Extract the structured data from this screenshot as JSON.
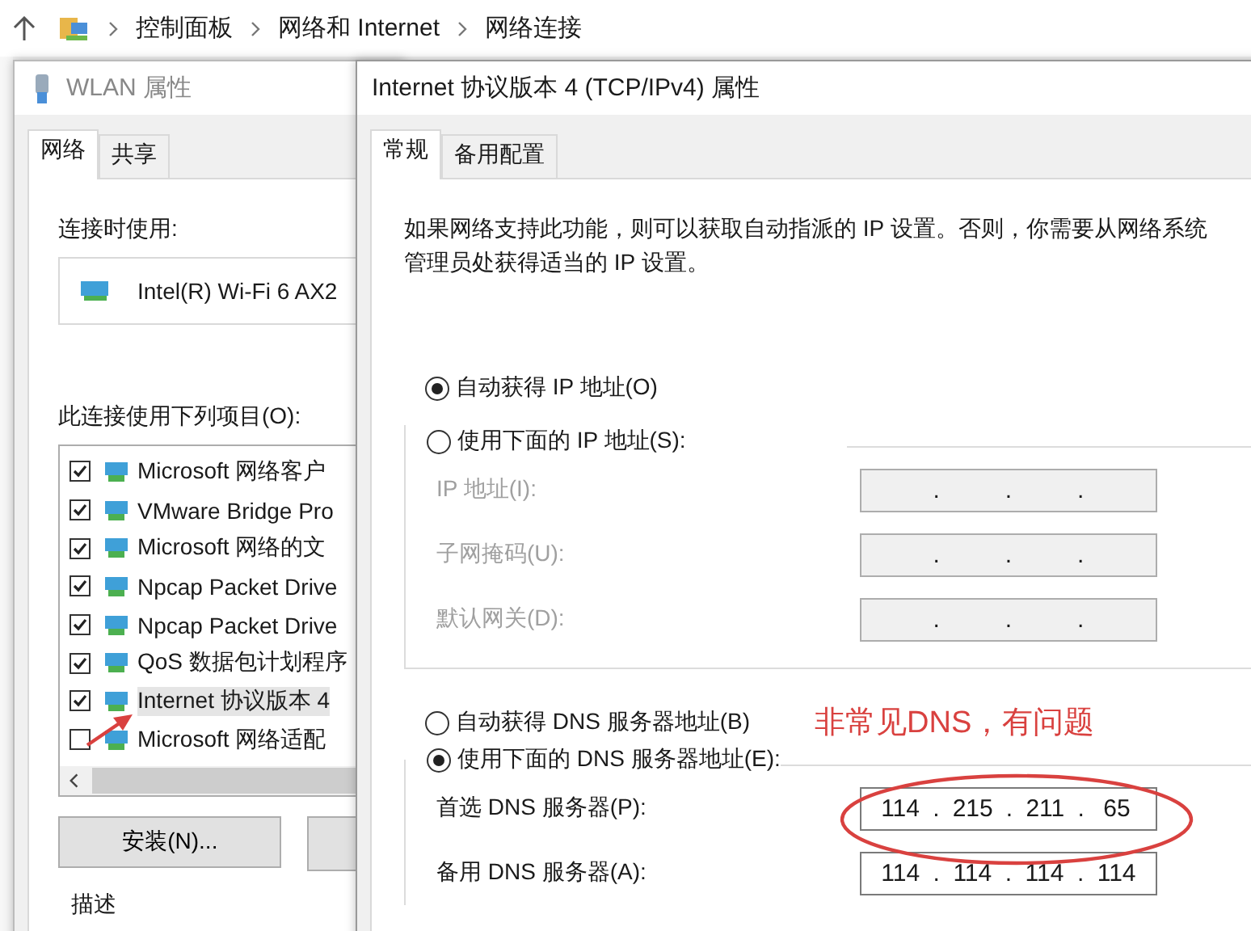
{
  "breadcrumb": {
    "items": [
      "控制面板",
      "网络和 Internet",
      "网络连接"
    ]
  },
  "wlan_window": {
    "title": "WLAN 属性",
    "tabs": [
      {
        "label": "网络",
        "selected": true
      },
      {
        "label": "共享",
        "selected": false
      }
    ],
    "connect_using_label": "连接时使用:",
    "adapter": "Intel(R) Wi-Fi 6 AX2",
    "items_label": "此连接使用下列项目(O):",
    "items": [
      {
        "label": "Microsoft 网络客户",
        "checked": true,
        "selected": false
      },
      {
        "label": "VMware Bridge Pro",
        "checked": true,
        "selected": false
      },
      {
        "label": "Microsoft 网络的文",
        "checked": true,
        "selected": false
      },
      {
        "label": "Npcap Packet Drive",
        "checked": true,
        "selected": false
      },
      {
        "label": "Npcap Packet Drive",
        "checked": true,
        "selected": false
      },
      {
        "label": "QoS 数据包计划程序",
        "checked": true,
        "selected": false
      },
      {
        "label": "Internet 协议版本 4",
        "checked": true,
        "selected": true
      },
      {
        "label": "Microsoft 网络适配",
        "checked": false,
        "selected": false
      }
    ],
    "install_button": "安装(N)...",
    "description_label": "描述"
  },
  "tcp_window": {
    "title": "Internet 协议版本 4 (TCP/IPv4) 属性",
    "tabs": [
      {
        "label": "常规",
        "selected": true
      },
      {
        "label": "备用配置",
        "selected": false
      }
    ],
    "description": "如果网络支持此功能，则可以获取自动指派的 IP 设置。否则，你需要从网络系统管理员处获得适当的 IP 设置。",
    "ip_mode": [
      {
        "label": "自动获得 IP 地址(O)",
        "selected": true
      },
      {
        "label": "使用下面的 IP 地址(S):",
        "selected": false
      }
    ],
    "ip_fields": [
      {
        "label": "IP 地址(I):",
        "disabled": true,
        "separators": [
          ".",
          ".",
          "."
        ]
      },
      {
        "label": "子网掩码(U):",
        "disabled": true,
        "separators": [
          ".",
          ".",
          "."
        ]
      },
      {
        "label": "默认网关(D):",
        "disabled": true,
        "separators": [
          ".",
          ".",
          "."
        ]
      }
    ],
    "dns_mode": [
      {
        "label": "自动获得 DNS 服务器地址(B)",
        "selected": false
      },
      {
        "label": "使用下面的 DNS 服务器地址(E):",
        "selected": true
      }
    ],
    "dns_fields": [
      {
        "label": "首选 DNS 服务器(P):",
        "disabled": false,
        "octets": [
          "114",
          "215",
          "211",
          "65"
        ],
        "separators": [
          ".",
          ".",
          "."
        ]
      },
      {
        "label": "备用 DNS 服务器(A):",
        "disabled": false,
        "octets": [
          "114",
          "114",
          "114",
          "114"
        ],
        "separators": [
          ".",
          ".",
          "."
        ]
      }
    ],
    "annotation": "非常见DNS，有问题"
  }
}
